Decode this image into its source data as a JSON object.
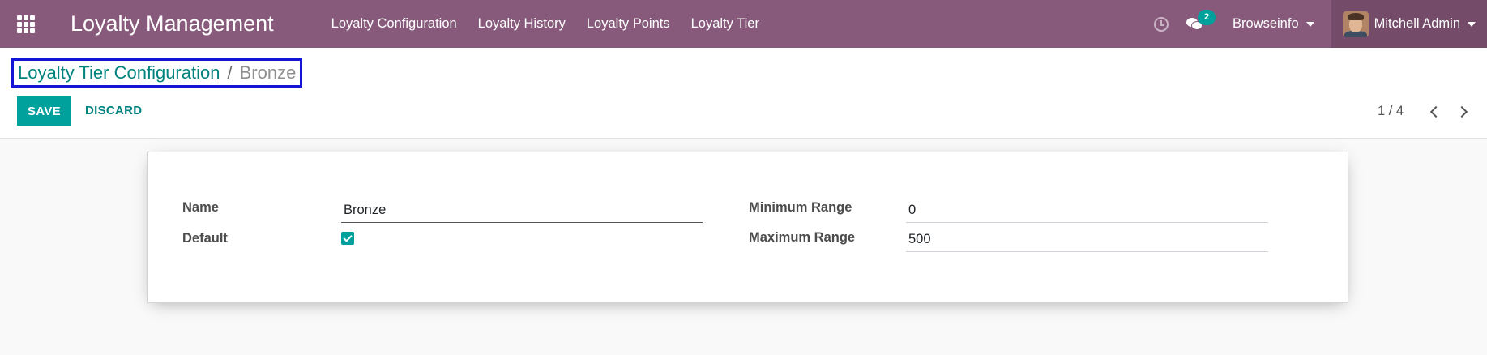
{
  "navbar": {
    "apps_icon": "apps-grid-icon",
    "brand": "Loyalty Management",
    "menu": [
      "Loyalty Configuration",
      "Loyalty History",
      "Loyalty Points",
      "Loyalty Tier"
    ],
    "activity_icon": "clock-icon",
    "messages_icon": "chat-icon",
    "messages_count": "2",
    "company": "Browseinfo",
    "user": "Mitchell Admin",
    "accent_color": "#875a7b"
  },
  "breadcrumb": {
    "parent": "Loyalty Tier Configuration",
    "separator": "/",
    "current": "Bronze"
  },
  "toolbar": {
    "save_label": "SAVE",
    "discard_label": "DISCARD",
    "primary_color": "#00a09d"
  },
  "pager": {
    "value": "1 / 4"
  },
  "form": {
    "name_label": "Name",
    "name_value": "Bronze",
    "default_label": "Default",
    "default_checked": true,
    "min_label": "Minimum Range",
    "min_value": "0",
    "max_label": "Maximum Range",
    "max_value": "500"
  }
}
